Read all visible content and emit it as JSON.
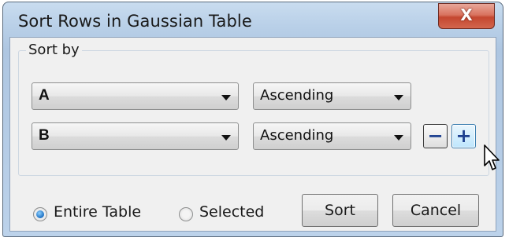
{
  "window": {
    "title": "Sort Rows in Gaussian Table",
    "close_glyph": "X"
  },
  "group": {
    "label": "Sort by",
    "rows": [
      {
        "column": "A",
        "order": "Ascending"
      },
      {
        "column": "B",
        "order": "Ascending"
      }
    ],
    "remove_glyph": "−",
    "add_glyph": "+"
  },
  "scope": {
    "options": [
      {
        "label": "Entire Table",
        "checked": true
      },
      {
        "label": "Selected",
        "checked": false
      }
    ]
  },
  "buttons": {
    "sort": "Sort",
    "cancel": "Cancel"
  },
  "icons": {
    "close": "close-icon",
    "dropdown": "chevron-down-icon",
    "remove": "minus-icon",
    "add": "plus-icon",
    "cursor": "mouse-pointer-icon"
  },
  "colors": {
    "titlebar": "#b9d0e8",
    "close_button": "#c44730",
    "radio_checked": "#1b6fc2",
    "add_button_hover": "#bee6fd"
  }
}
